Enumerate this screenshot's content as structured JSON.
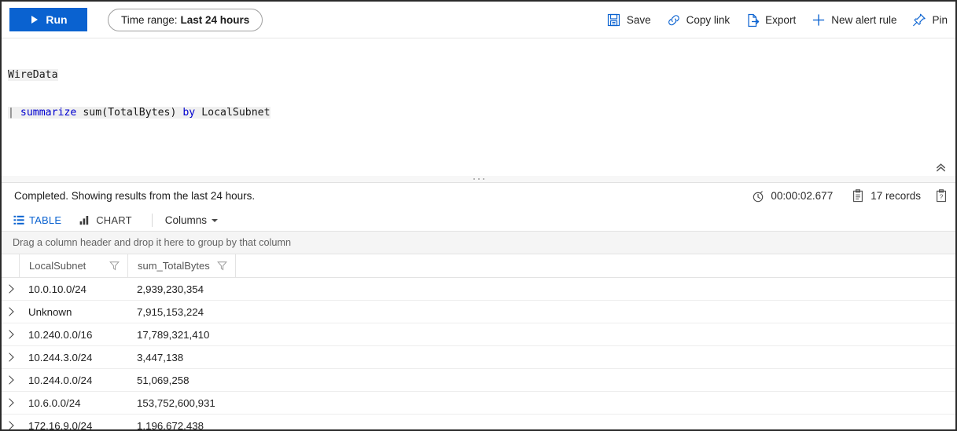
{
  "toolbar": {
    "run_label": "Run",
    "run_icon": "play-icon",
    "timerange_label": "Time range:",
    "timerange_value": "Last 24 hours",
    "actions": [
      {
        "label": "Save",
        "icon": "save-icon"
      },
      {
        "label": "Copy link",
        "icon": "link-icon"
      },
      {
        "label": "Export",
        "icon": "export-icon"
      },
      {
        "label": "New alert rule",
        "icon": "plus-icon"
      },
      {
        "label": "Pin",
        "icon": "pin-icon"
      }
    ],
    "accent_color": "#0a62d0"
  },
  "editor": {
    "line1": "WireData",
    "line2_pipe": "|",
    "line2_kw1": "summarize",
    "line2_fn": " sum(TotalBytes) ",
    "line2_kw2": "by",
    "line2_col": " LocalSubnet",
    "collapse_icon": "double-chevron-up-icon",
    "splitter_icon": "splitter-grip-icon"
  },
  "status": {
    "message": "Completed. Showing results from the last 24 hours.",
    "duration": "00:00:02.677",
    "duration_icon": "timer-icon",
    "records": "17 records",
    "records_icon": "clipboard-icon",
    "details_icon": "clipboard-question-icon"
  },
  "viewtabs": {
    "table_label": "TABLE",
    "table_icon": "table-icon",
    "chart_label": "CHART",
    "chart_icon": "bar-chart-icon",
    "columns_label": "Columns",
    "columns_icon": "chevron-down-icon",
    "active": "TABLE"
  },
  "grid": {
    "group_hint": "Drag a column header and drop it here to group by that column",
    "filter_icon": "funnel-icon",
    "expand_icon": "chevron-right-icon",
    "columns": [
      "LocalSubnet",
      "sum_TotalBytes"
    ],
    "rows": [
      {
        "LocalSubnet": "10.0.10.0/24",
        "sum_TotalBytes": "2,939,230,354"
      },
      {
        "LocalSubnet": "Unknown",
        "sum_TotalBytes": "7,915,153,224"
      },
      {
        "LocalSubnet": "10.240.0.0/16",
        "sum_TotalBytes": "17,789,321,410"
      },
      {
        "LocalSubnet": "10.244.3.0/24",
        "sum_TotalBytes": "3,447,138"
      },
      {
        "LocalSubnet": "10.244.0.0/24",
        "sum_TotalBytes": "51,069,258"
      },
      {
        "LocalSubnet": "10.6.0.0/24",
        "sum_TotalBytes": "153,752,600,931"
      },
      {
        "LocalSubnet": "172.16.9.0/24",
        "sum_TotalBytes": "1,196,672,438"
      }
    ]
  }
}
